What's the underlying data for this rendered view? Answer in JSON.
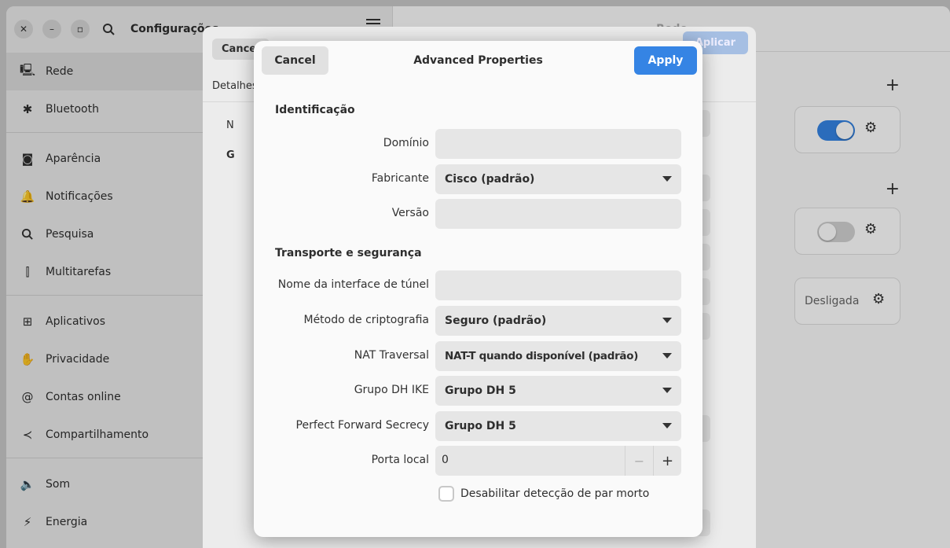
{
  "main_window": {
    "title": "Configurações",
    "content_title": "Rede",
    "sidebar": {
      "items": [
        {
          "label": "Rede",
          "icon": "network-icon",
          "active": true
        },
        {
          "label": "Bluetooth",
          "icon": "bluetooth-icon"
        },
        {
          "label": "Aparência",
          "icon": "appearance-icon"
        },
        {
          "label": "Notificações",
          "icon": "bell-icon"
        },
        {
          "label": "Pesquisa",
          "icon": "search-icon"
        },
        {
          "label": "Multitarefas",
          "icon": "multitask-icon"
        },
        {
          "label": "Aplicativos",
          "icon": "apps-grid-icon"
        },
        {
          "label": "Privacidade",
          "icon": "hand-icon"
        },
        {
          "label": "Contas online",
          "icon": "at-icon"
        },
        {
          "label": "Compartilhamento",
          "icon": "share-icon"
        },
        {
          "label": "Som",
          "icon": "speaker-icon"
        },
        {
          "label": "Energia",
          "icon": "power-icon"
        }
      ]
    },
    "vpn_status": "Desligada"
  },
  "mid_dialog": {
    "cancel_label": "Cancel",
    "apply_label": "Aplicar",
    "tab_label": "Detalhes",
    "field_n": "N",
    "field_g": "G"
  },
  "dialog": {
    "title": "Advanced Properties",
    "cancel_label": "Cancel",
    "apply_label": "Apply",
    "section_identification": "Identificação",
    "domain_label": "Domínio",
    "domain_value": "",
    "vendor_label": "Fabricante",
    "vendor_value": "Cisco (padrão)",
    "version_label": "Versão",
    "version_value": "",
    "section_transport": "Transporte e segurança",
    "tunnel_label": "Nome da interface de túnel",
    "tunnel_value": "",
    "crypto_label": "Método de criptografia",
    "crypto_value": "Seguro (padrão)",
    "nat_label": "NAT Traversal",
    "nat_value": "NAT-T quando disponível (padrão)",
    "dh_label": "Grupo DH IKE",
    "dh_value": "Grupo DH 5",
    "pfs_label": "Perfect Forward Secrecy",
    "pfs_value": "Grupo DH 5",
    "port_label": "Porta local",
    "port_value": "0",
    "dpd_label": "Desabilitar detecção de par morto"
  },
  "colors": {
    "accent": "#3584e4",
    "toggle_off": "#d2d2d2"
  }
}
